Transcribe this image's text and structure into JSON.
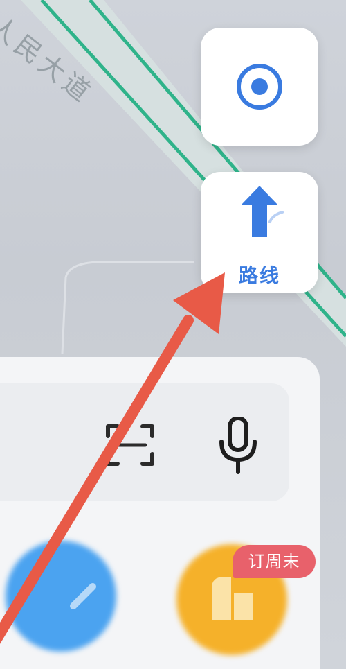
{
  "map": {
    "road_name": "人民大道"
  },
  "controls": {
    "locate_icon": "locate-icon",
    "route_icon": "route-arrow-icon",
    "route_label": "路线"
  },
  "search": {
    "scan_icon": "scan-icon",
    "mic_icon": "microphone-icon"
  },
  "shortcuts": {
    "badge": "订周末"
  },
  "annotation": {
    "arrow_color": "#e85a47"
  },
  "colors": {
    "accent": "#3a7be0",
    "road_green": "#2fb38a",
    "badge": "#e8616b",
    "shortcut_blue": "#4ba3f0",
    "shortcut_orange": "#f5b12a"
  }
}
